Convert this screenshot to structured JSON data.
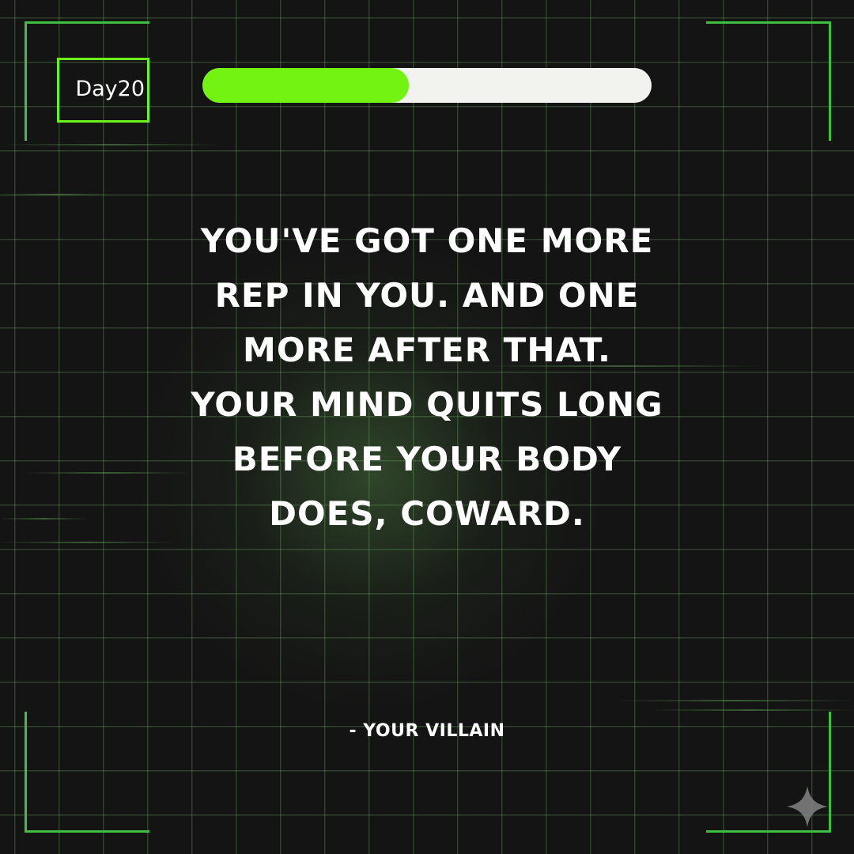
{
  "day_badge": {
    "text": "Day20"
  },
  "progress": {
    "fraction": 0.46,
    "fill_color": "#73f312",
    "track_color": "#f2f2ee"
  },
  "quote": {
    "lines": [
      "YOU'VE GOT ONE MORE",
      "REP IN YOU. AND ONE",
      "MORE AFTER THAT.",
      "YOUR MIND QUITS LONG",
      "BEFORE YOUR BODY",
      "DOES, COWARD."
    ]
  },
  "attribution": "- YOUR VILLAIN",
  "icons": {
    "corner": "sparkle-icon"
  },
  "colors": {
    "accent": "#6df31c",
    "frame": "#3fbf3f",
    "background": "#141414"
  }
}
